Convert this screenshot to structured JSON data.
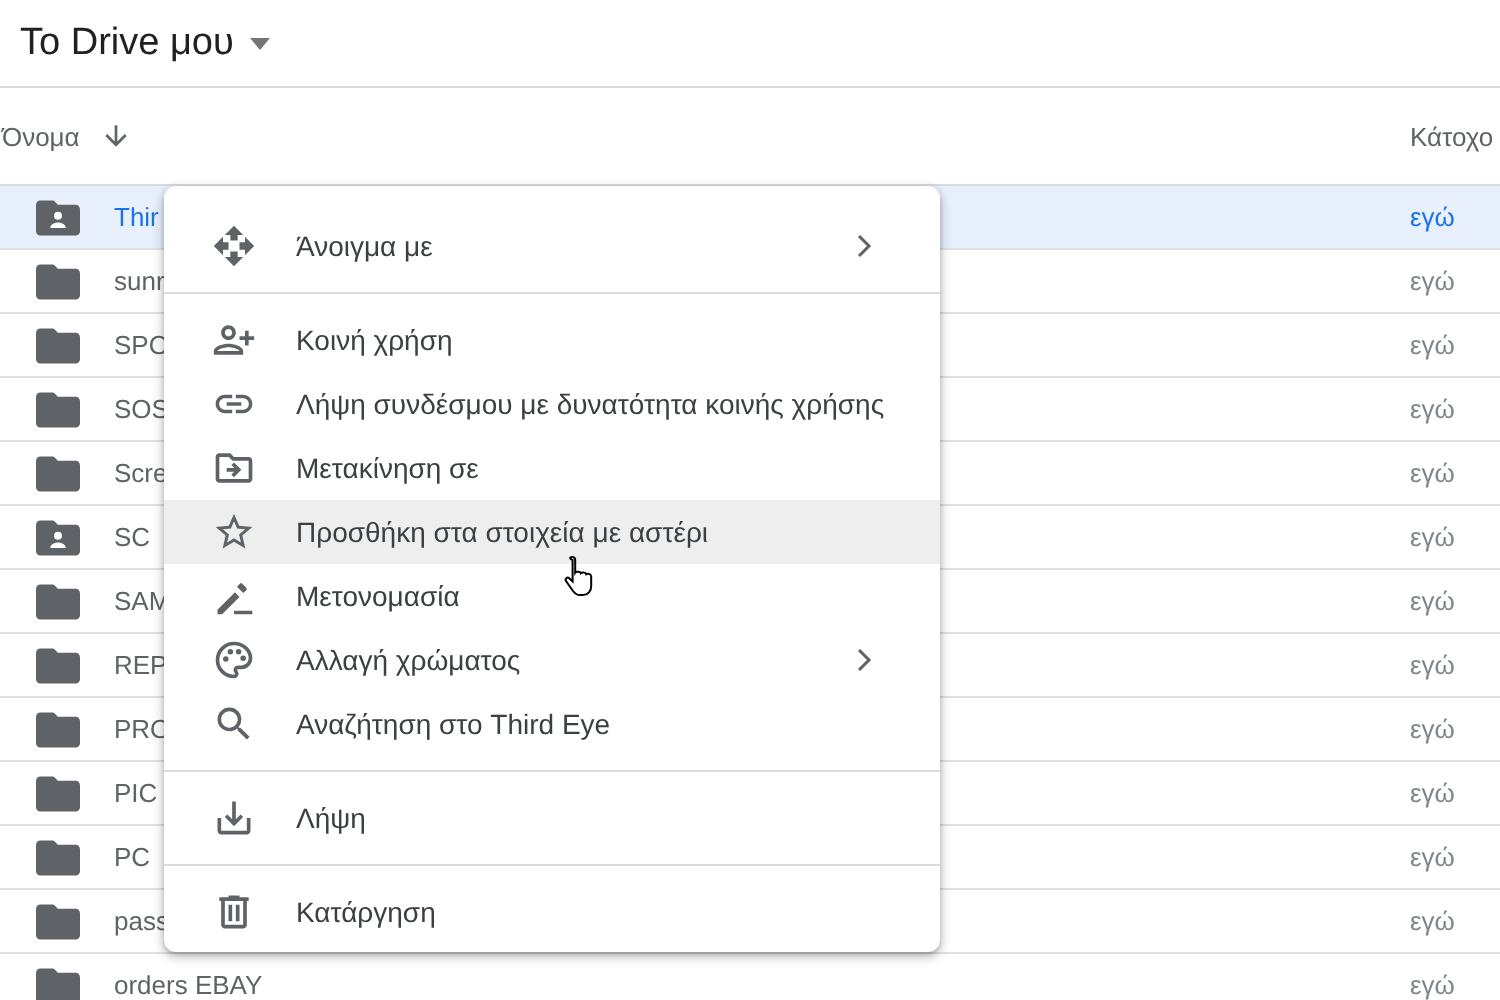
{
  "title": "To Drive μου",
  "table": {
    "columns": [
      "Όνομα",
      "Κάτοχο"
    ],
    "rows": [
      {
        "kind": "shared",
        "name": "Thir",
        "owner": "εγώ",
        "selected": true
      },
      {
        "kind": "folder",
        "name": "sunr",
        "owner": "εγώ",
        "selected": false
      },
      {
        "kind": "folder",
        "name": "SPO",
        "owner": "εγώ",
        "selected": false
      },
      {
        "kind": "folder",
        "name": "SOS",
        "owner": "εγώ",
        "selected": false
      },
      {
        "kind": "folder",
        "name": "Scre",
        "owner": "εγώ",
        "selected": false
      },
      {
        "kind": "shared",
        "name": "SC",
        "owner": "εγώ",
        "selected": false
      },
      {
        "kind": "folder",
        "name": "SAM",
        "owner": "εγώ",
        "selected": false
      },
      {
        "kind": "folder",
        "name": "REP",
        "owner": "εγώ",
        "selected": false
      },
      {
        "kind": "folder",
        "name": "PRO",
        "owner": "εγώ",
        "selected": false
      },
      {
        "kind": "folder",
        "name": "PIC",
        "owner": "εγώ",
        "selected": false
      },
      {
        "kind": "folder",
        "name": "PC",
        "owner": "εγώ",
        "selected": false
      },
      {
        "kind": "folder",
        "name": "pass",
        "owner": "εγώ",
        "selected": false
      },
      {
        "kind": "folder",
        "name": "orders EBAY",
        "owner": "εγώ",
        "selected": false
      }
    ]
  },
  "context_menu": {
    "groups": [
      [
        {
          "kind": "open",
          "label": "Άνοιγμα με",
          "submenu": true,
          "highlighted": false
        }
      ],
      [
        {
          "kind": "share",
          "label": "Κοινή χρήση",
          "submenu": false,
          "highlighted": false
        },
        {
          "kind": "link",
          "label": "Λήψη συνδέσμου με δυνατότητα κοινής χρήσης",
          "submenu": false,
          "highlighted": false
        },
        {
          "kind": "move",
          "label": "Μετακίνηση σε",
          "submenu": false,
          "highlighted": false
        },
        {
          "kind": "star",
          "label": "Προσθήκη στα στοιχεία με αστέρι",
          "submenu": false,
          "highlighted": true
        },
        {
          "kind": "rename",
          "label": "Μετονομασία",
          "submenu": false,
          "highlighted": false
        },
        {
          "kind": "color",
          "label": "Αλλαγή χρώματος",
          "submenu": true,
          "highlighted": false
        },
        {
          "kind": "search",
          "label": "Αναζήτηση στο Third Eye",
          "submenu": false,
          "highlighted": false
        }
      ],
      [
        {
          "kind": "download",
          "label": "Λήψη",
          "submenu": false,
          "highlighted": false
        }
      ],
      [
        {
          "kind": "delete",
          "label": "Κατάργηση",
          "submenu": false,
          "highlighted": false
        }
      ]
    ]
  }
}
